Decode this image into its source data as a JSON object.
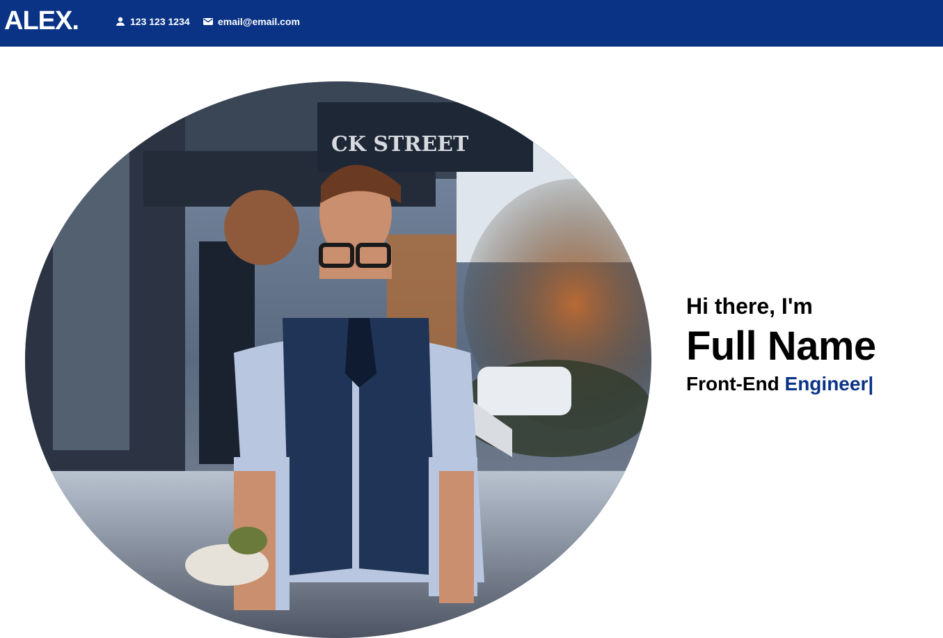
{
  "header": {
    "logo": "ALEX.",
    "phone": {
      "icon": "person-icon",
      "text": "123 123 1234"
    },
    "email": {
      "icon": "mail-icon",
      "text": "email@email.com"
    }
  },
  "hero": {
    "greeting": "Hi there, I'm",
    "name": "Full Name",
    "role_prefix": "Front-End",
    "role_highlight": "Engineer|"
  },
  "colors": {
    "brand": "#0a3386",
    "text": "#000000",
    "background": "#ffffff"
  }
}
